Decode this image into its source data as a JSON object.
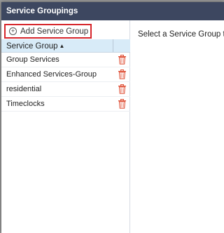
{
  "dialog": {
    "title": "Service Groupings",
    "add_button_label": "Add Service Group",
    "placeholder": "Select a Service Group to view details",
    "column_header": "Service Group",
    "rows": [
      {
        "name": "Group Services"
      },
      {
        "name": "Enhanced Services-Group"
      },
      {
        "name": "residential"
      },
      {
        "name": "Timeclocks"
      }
    ]
  },
  "colors": {
    "titlebar": "#3d4760",
    "header_row": "#d8ebf8",
    "highlight_border": "#d6262b",
    "trash_icon": "#e0553c"
  },
  "icons": {
    "add": "plus-circle-icon",
    "sort": "sort-ascending-icon",
    "delete": "trash-icon"
  }
}
